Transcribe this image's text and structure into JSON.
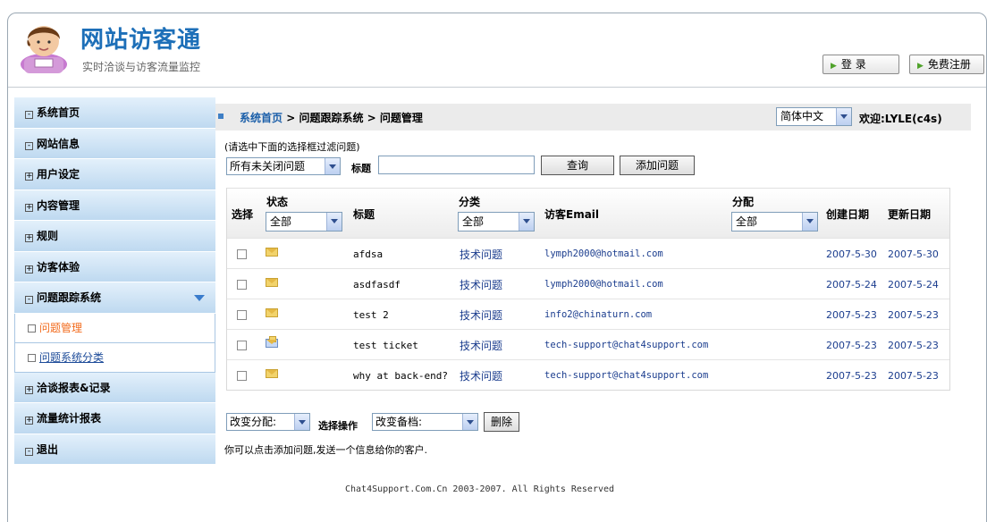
{
  "header": {
    "title": "网站访客通",
    "subtitle": "实时洽谈与访客流量监控",
    "login_label": "登 录",
    "register_label": "免费注册"
  },
  "sidebar": {
    "items": [
      {
        "label": "系统首页",
        "box": "-"
      },
      {
        "label": "网站信息",
        "box": "-"
      },
      {
        "label": "用户设定",
        "box": "+"
      },
      {
        "label": "内容管理",
        "box": "+"
      },
      {
        "label": "规则",
        "box": "+"
      },
      {
        "label": "访客体验",
        "box": "+"
      },
      {
        "label": "问题跟踪系统",
        "box": "-"
      },
      {
        "label": "洽谈报表&记录",
        "box": "+"
      },
      {
        "label": "流量统计报表",
        "box": "+"
      },
      {
        "label": "退出",
        "box": "-"
      }
    ],
    "subitems": [
      {
        "label": "问题管理"
      },
      {
        "label": "问题系统分类"
      }
    ]
  },
  "breadcrumb": {
    "home": "系统首页",
    "sep1": " > ",
    "level2": "问题跟踪系统",
    "sep2": " > ",
    "current": "问题管理"
  },
  "language": "简体中文",
  "welcome": "欢迎:LYLE(c4s)",
  "filter": {
    "hint": "(请选中下面的选择框过滤问题)",
    "status_filter": "所有未关闭问题",
    "title_label": "标题",
    "title_value": "",
    "query_button": "查询",
    "add_button": "添加问题"
  },
  "table": {
    "headers": {
      "select": "选择",
      "status": "状态",
      "title": "标题",
      "category": "分类",
      "email": "访客Email",
      "assign": "分配",
      "created": "创建日期",
      "updated": "更新日期"
    },
    "status_filter": "全部",
    "category_filter": "全部",
    "assign_filter": "全部",
    "rows": [
      {
        "title": "afdsa",
        "category": "技术问题",
        "email": "lymph2000@hotmail.com",
        "created": "2007-5-30",
        "updated": "2007-5-30",
        "icon": "envelope-icon"
      },
      {
        "title": "asdfasdf",
        "category": "技术问题",
        "email": "lymph2000@hotmail.com",
        "created": "2007-5-24",
        "updated": "2007-5-24",
        "icon": "envelope-icon"
      },
      {
        "title": "test 2",
        "category": "技术问题",
        "email": "info2@chinaturn.com",
        "created": "2007-5-23",
        "updated": "2007-5-23",
        "icon": "envelope-icon"
      },
      {
        "title": "test ticket",
        "category": "技术问题",
        "email": "tech-support@chat4support.com",
        "created": "2007-5-23",
        "updated": "2007-5-23",
        "icon": "reply-envelope-icon"
      },
      {
        "title": "why at back-end?",
        "category": "技术问题",
        "email": "tech-support@chat4support.com",
        "created": "2007-5-23",
        "updated": "2007-5-23",
        "icon": "envelope-icon"
      }
    ]
  },
  "actions": {
    "assign_select": "改变分配:",
    "operation_label": "选择操作",
    "archive_select": "改变备档:",
    "delete_button": "删除"
  },
  "note": "你可以点击添加问题,发送一个信息给你的客户.",
  "footer": "Chat4Support.Com.Cn 2003-2007. All Rights Reserved",
  "colors": {
    "brand": "#1d6fb8",
    "sidebar_bg": "#bed9f0",
    "link": "#1b3d8e",
    "active": "#f26b1d"
  }
}
